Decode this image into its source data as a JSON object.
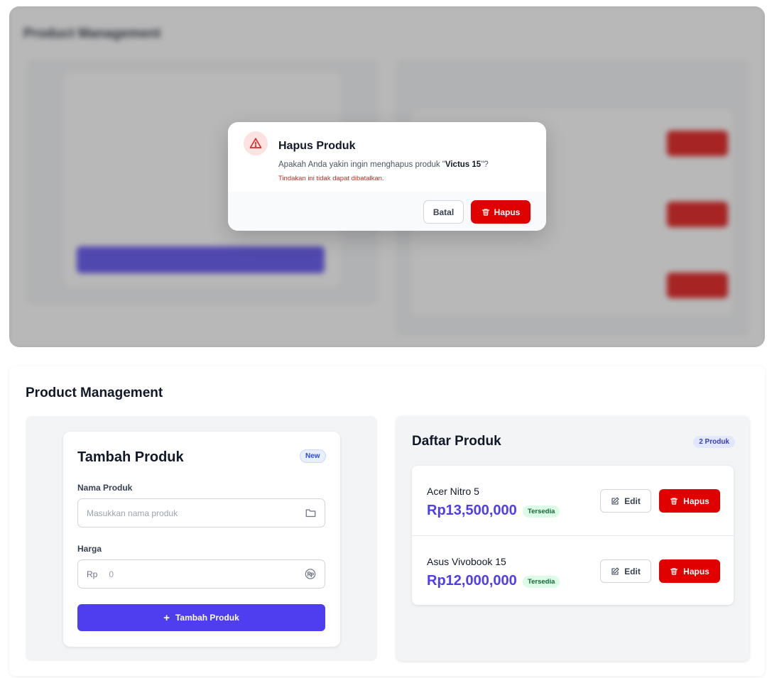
{
  "app": {
    "title": "Product Management"
  },
  "modal": {
    "title": "Hapus Produk",
    "message_prefix": "Apakah Anda yakin ingin menghapus produk \"",
    "product_name": "Victus 15",
    "message_suffix": "\"?",
    "note": "Tindakan ini tidak dapat dibatalkan.",
    "cancel_label": "Batal",
    "confirm_label": "Hapus"
  },
  "form": {
    "title": "Tambah Produk",
    "badge": "New",
    "name_label": "Nama Produk",
    "name_placeholder": "Masukkan nama produk",
    "price_label": "Harga",
    "price_prefix": "Rp",
    "price_placeholder": "0",
    "submit_label": "Tambah Produk"
  },
  "list": {
    "title": "Daftar Produk",
    "count_badge": "2 Produk",
    "edit_label": "Edit",
    "delete_label": "Hapus",
    "items": [
      {
        "name": "Acer Nitro 5",
        "price": "Rp13,500,000",
        "status": "Tersedia"
      },
      {
        "name": "Asus Vivobook 15",
        "price": "Rp12,000,000",
        "status": "Tersedia"
      }
    ]
  },
  "colors": {
    "primary": "#4f3ef0",
    "danger": "#e00000",
    "success_bg": "#dcfce7",
    "success_text": "#166534"
  }
}
